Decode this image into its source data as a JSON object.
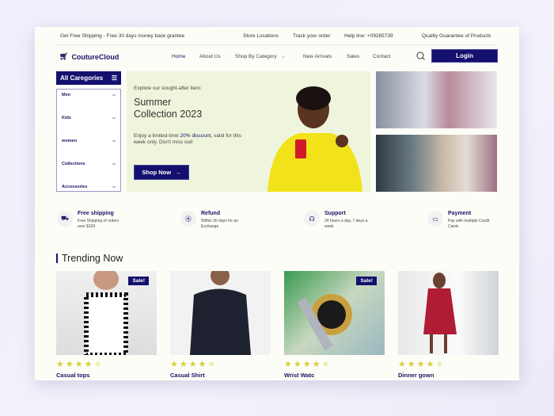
{
  "topbar": {
    "promo": "Get Free Shipping - Free 30 days money back grantee",
    "store": "Store Locations",
    "track": "Track your order",
    "help": "Help line: +09285739",
    "quality": "Quality Guarantee of Products"
  },
  "brand": "CoutureCloud",
  "nav": [
    "Home",
    "About Us",
    "Shop By Category",
    "New Arrivals",
    "Sales",
    "Contact"
  ],
  "login": "Login",
  "categories": {
    "title": "All Caregories",
    "items": [
      "Men",
      "Kids",
      "women",
      "Collections",
      "Accessories"
    ]
  },
  "hero": {
    "eyebrow": "Explore our sought-after item:",
    "title1": "Summer",
    "title2": "Collection 2023",
    "desc_pre": "Enjoy a limited-time ",
    "desc_hl": "20% discount",
    "desc_post": ", valid for this week only. Don't miss out!",
    "cta": "Shop Now"
  },
  "features": [
    {
      "icon": "truck-icon",
      "title": "Free shipping",
      "desc": "Free Shipping of orders over $100"
    },
    {
      "icon": "refund-icon",
      "title": "Refund",
      "desc": "Within 30 days for an Exchange"
    },
    {
      "icon": "headset-icon",
      "title": "Support",
      "desc": "24 hours a day, 7 days a week"
    },
    {
      "icon": "credit-card-icon",
      "title": "Payment",
      "desc": "Pay with multiple Credit Cards"
    }
  ],
  "trending": {
    "title": "Trending Now",
    "products": [
      {
        "name": "Casual tops",
        "badge": "Sale!",
        "rating": 4
      },
      {
        "name": "Casual Shirt",
        "badge": "",
        "rating": 4
      },
      {
        "name": "Wrist Watc",
        "badge": "Sale!",
        "rating": 4
      },
      {
        "name": "Dinner gown",
        "badge": "",
        "rating": 4
      }
    ]
  },
  "colors": {
    "primary": "#14106e",
    "hero_bg": "#eff5dc",
    "star": "#d6cf3a"
  }
}
